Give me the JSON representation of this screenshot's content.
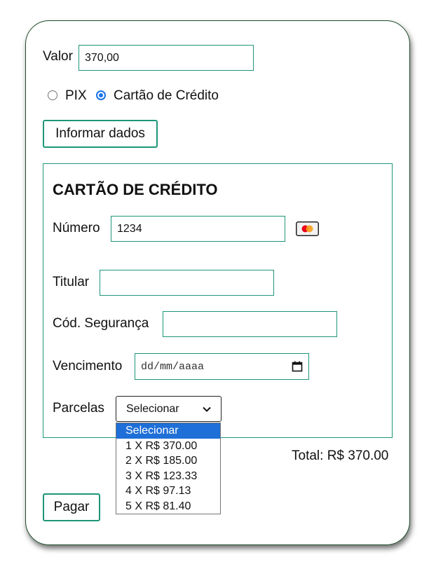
{
  "payment": {
    "valor_label": "Valor",
    "valor_value": "370,00",
    "method_options": [
      {
        "label": "PIX",
        "checked": false
      },
      {
        "label": "Cartão de Crédito",
        "checked": true
      }
    ],
    "inform_button": "Informar dados"
  },
  "card_section": {
    "title": "CARTÃO DE CRÉDITO",
    "numero_label": "Número",
    "numero_value": "1234",
    "card_brand_icon": "mastercard-icon",
    "titular_label": "Titular",
    "titular_value": "",
    "cod_label": "Cód. Segurança",
    "cod_value": "",
    "vencimento_label": "Vencimento",
    "vencimento_placeholder": "dd/mm/aaaa",
    "parcelas_label": "Parcelas",
    "parcelas_selected": "Selecionar",
    "parcelas_options": [
      "Selecionar",
      "1 X R$ 370.00",
      "2 X R$ 185.00",
      "3 X R$ 123.33",
      "4 X R$ 97.13",
      "5 X R$ 81.40"
    ]
  },
  "total": "Total: R$ 370.00",
  "pay_button": "Pagar",
  "colors": {
    "accent": "#1e9678",
    "radio": "#1a73e8",
    "highlight": "#1f6fd8"
  }
}
